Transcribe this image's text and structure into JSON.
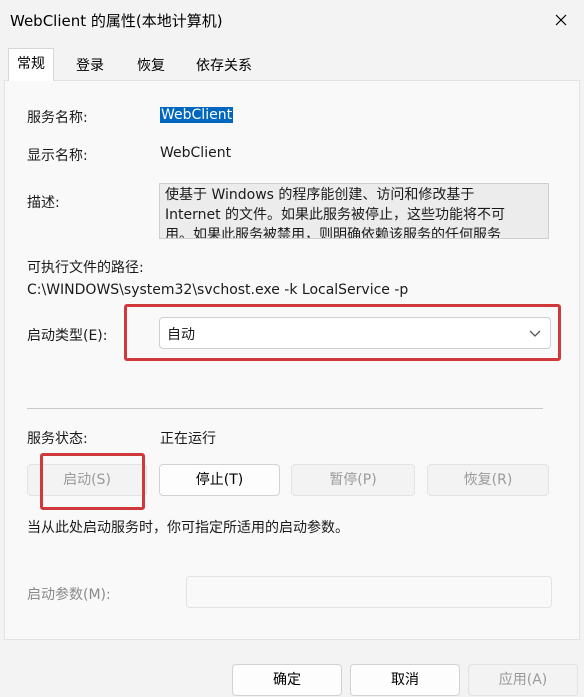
{
  "window": {
    "title": "WebClient 的属性(本地计算机)",
    "close_icon": "close-icon"
  },
  "tabs": [
    {
      "label": "常规",
      "active": true
    },
    {
      "label": "登录",
      "active": false
    },
    {
      "label": "恢复",
      "active": false
    },
    {
      "label": "依存关系",
      "active": false
    }
  ],
  "general": {
    "service_name_label": "服务名称:",
    "service_name_value": "WebClient",
    "display_name_label": "显示名称:",
    "display_name_value": "WebClient",
    "description_label": "描述:",
    "description_value": "使基于 Windows 的程序能创建、访问和修改基于 Internet 的文件。如果此服务被停止，这些功能将不可用。如果此服务被禁用，则明确依赖该服务的任何服务",
    "path_label": "可执行文件的路径:",
    "path_value": "C:\\WINDOWS\\system32\\svchost.exe -k LocalService -p",
    "startup_type_label": "启动类型(E):",
    "startup_type_value": "自动",
    "service_status_label": "服务状态:",
    "service_status_value": "正在运行",
    "buttons": {
      "start": "启动(S)",
      "stop": "停止(T)",
      "pause": "暂停(P)",
      "resume": "恢复(R)"
    },
    "hint_text": "当从此处启动服务时，你可指定所适用的启动参数。",
    "start_params_label": "启动参数(M):",
    "start_params_value": ""
  },
  "footer": {
    "ok": "确定",
    "cancel": "取消",
    "apply": "应用(A)"
  },
  "colors": {
    "highlight_rect": "#d0393c",
    "selection": "#0067c0"
  }
}
